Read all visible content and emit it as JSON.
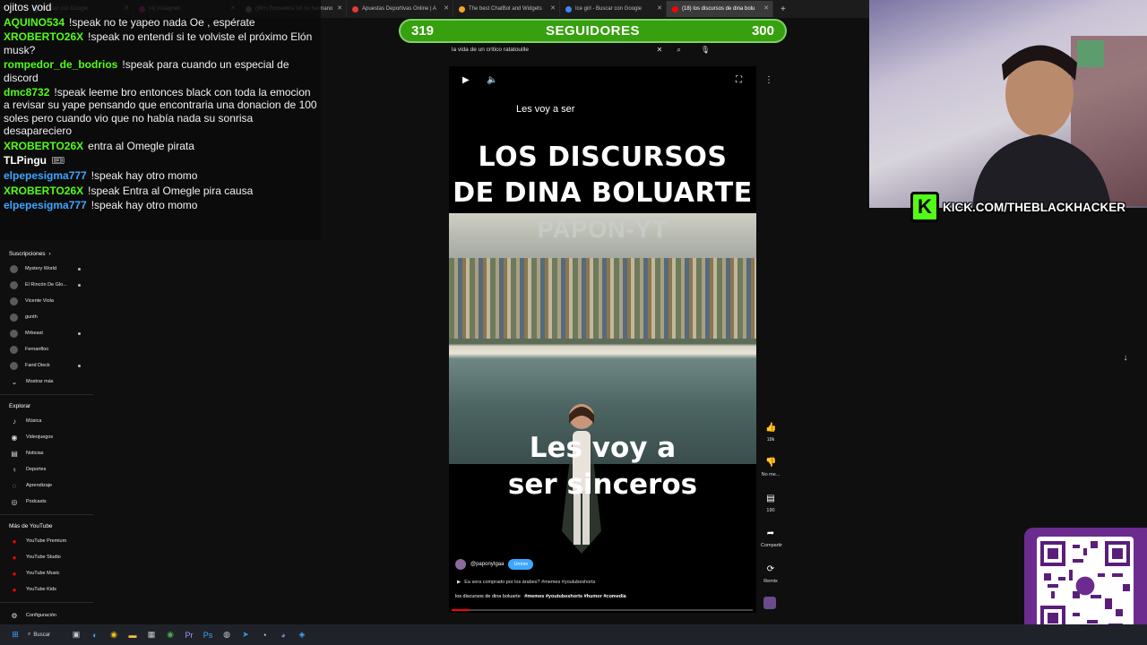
{
  "browser": {
    "tabs": [
      {
        "label": "Buscar con Google",
        "color": "#4285f4",
        "active": false
      },
      {
        "label": "(4) Instagram",
        "color": "#d6249f",
        "active": false
      },
      {
        "label": "(99+) Encuentra 'oh no hermano",
        "color": "#888888",
        "active": false
      },
      {
        "label": "Apuestas Deportivas Online | A",
        "color": "#e53935",
        "active": false
      },
      {
        "label": "The best ChatBot and Widgets",
        "color": "#f5a623",
        "active": false
      },
      {
        "label": "Ice girl - Buscar con Google",
        "color": "#4285f4",
        "active": false
      },
      {
        "label": "(18) los discursos de dina bolu",
        "color": "#ff0000",
        "active": true
      }
    ],
    "new_tab": "+",
    "close": "✕"
  },
  "chat": {
    "messages": [
      {
        "user": "",
        "text": "ojitos void",
        "color": "#ffffff"
      },
      {
        "user": "AQUINO534",
        "text": "!speak no te yapeo nada Oe , espérate",
        "color": "#53fc18"
      },
      {
        "user": "XROBERTO26X",
        "text": "!speak no entendí si te volviste el próximo Elón musk?",
        "color": "#53fc18"
      },
      {
        "user": "rompedor_de_bodrios",
        "text": "!speak para cuando un especial de discord",
        "color": "#53fc18"
      },
      {
        "user": "dmc8732",
        "text": "!speak leeme bro entonces black con toda la emocion a revisar su yape pensando que encontraria una donacion de 100 soles pero cuando vio que no había nada su sonrisa desapareciero",
        "color": "#53fc18"
      },
      {
        "user": "XROBERTO26X",
        "text": "entra al Omegle pirata",
        "color": "#53fc18"
      },
      {
        "user": "TLPingu",
        "text": "🎟",
        "color": "#ffffff"
      },
      {
        "user": "elpepesigma777",
        "text": "!speak hay otro momo",
        "color": "#3ea6ff"
      },
      {
        "user": "XROBERTO26X",
        "text": "!speak Entra al Omegle pira causa",
        "color": "#53fc18"
      },
      {
        "user": "elpepesigma777",
        "text": "!speak hay otro momo",
        "color": "#3ea6ff"
      }
    ]
  },
  "followers": {
    "current": "319",
    "label": "SEGUIDORES",
    "goal": "300",
    "bar_color": "#37a00f"
  },
  "search": {
    "query": "la vida de un crítico ratatouille"
  },
  "sidebar": {
    "subscriptions_title": "Suscripciones",
    "subscriptions": [
      {
        "label": "Mystery World"
      },
      {
        "label": "El Rincón De Glo..."
      },
      {
        "label": "Vicente Viola"
      },
      {
        "label": "gunth"
      },
      {
        "label": "Mrbeast"
      },
      {
        "label": "Fernanflоо"
      },
      {
        "label": "Farid Dieck"
      },
      {
        "label": "Mostrar más"
      }
    ],
    "explore_title": "Explorar",
    "explore": [
      {
        "label": "Música",
        "icon": "♪"
      },
      {
        "label": "Videojuegos",
        "icon": "◉"
      },
      {
        "label": "Noticias",
        "icon": "▤"
      },
      {
        "label": "Deportes",
        "icon": "♀"
      },
      {
        "label": "Aprendizaje",
        "icon": "◌"
      },
      {
        "label": "Podcasts",
        "icon": "◎"
      }
    ],
    "more_title": "Más de YouTube",
    "more": [
      {
        "label": "YouTube Premium"
      },
      {
        "label": "YouTube Studio"
      },
      {
        "label": "YouTube Music"
      },
      {
        "label": "YouTube Kids"
      }
    ],
    "settings": "Configuración"
  },
  "video": {
    "caption_top": "Les voy a ser",
    "title_top": "LOS DISCURSOS\nDE DINA BOLUARTE",
    "watermark": "PAPON-YT",
    "title_bottom": "Les voy a\nser sinceros",
    "channel": "@paponytgaa",
    "subscribe": "Unirse",
    "related": "Ea sera comprado por los árabes? #memes #youtubeshorts",
    "description": "los discursos de dina boluarte",
    "hashtags": "#memes #youtubeshorts #humor #comedia"
  },
  "rail": {
    "likes": "18k",
    "dislike": "No me...",
    "comments": "190",
    "share": "Compartir",
    "remix": "Remix"
  },
  "overlay": {
    "kick_text": "KICK.COM/THEBLACKHACKER",
    "kick_logo": "K",
    "kick_color": "#53fc18",
    "qr_color": "#6b2b8f"
  },
  "taskbar": {
    "search": "Buscar"
  }
}
